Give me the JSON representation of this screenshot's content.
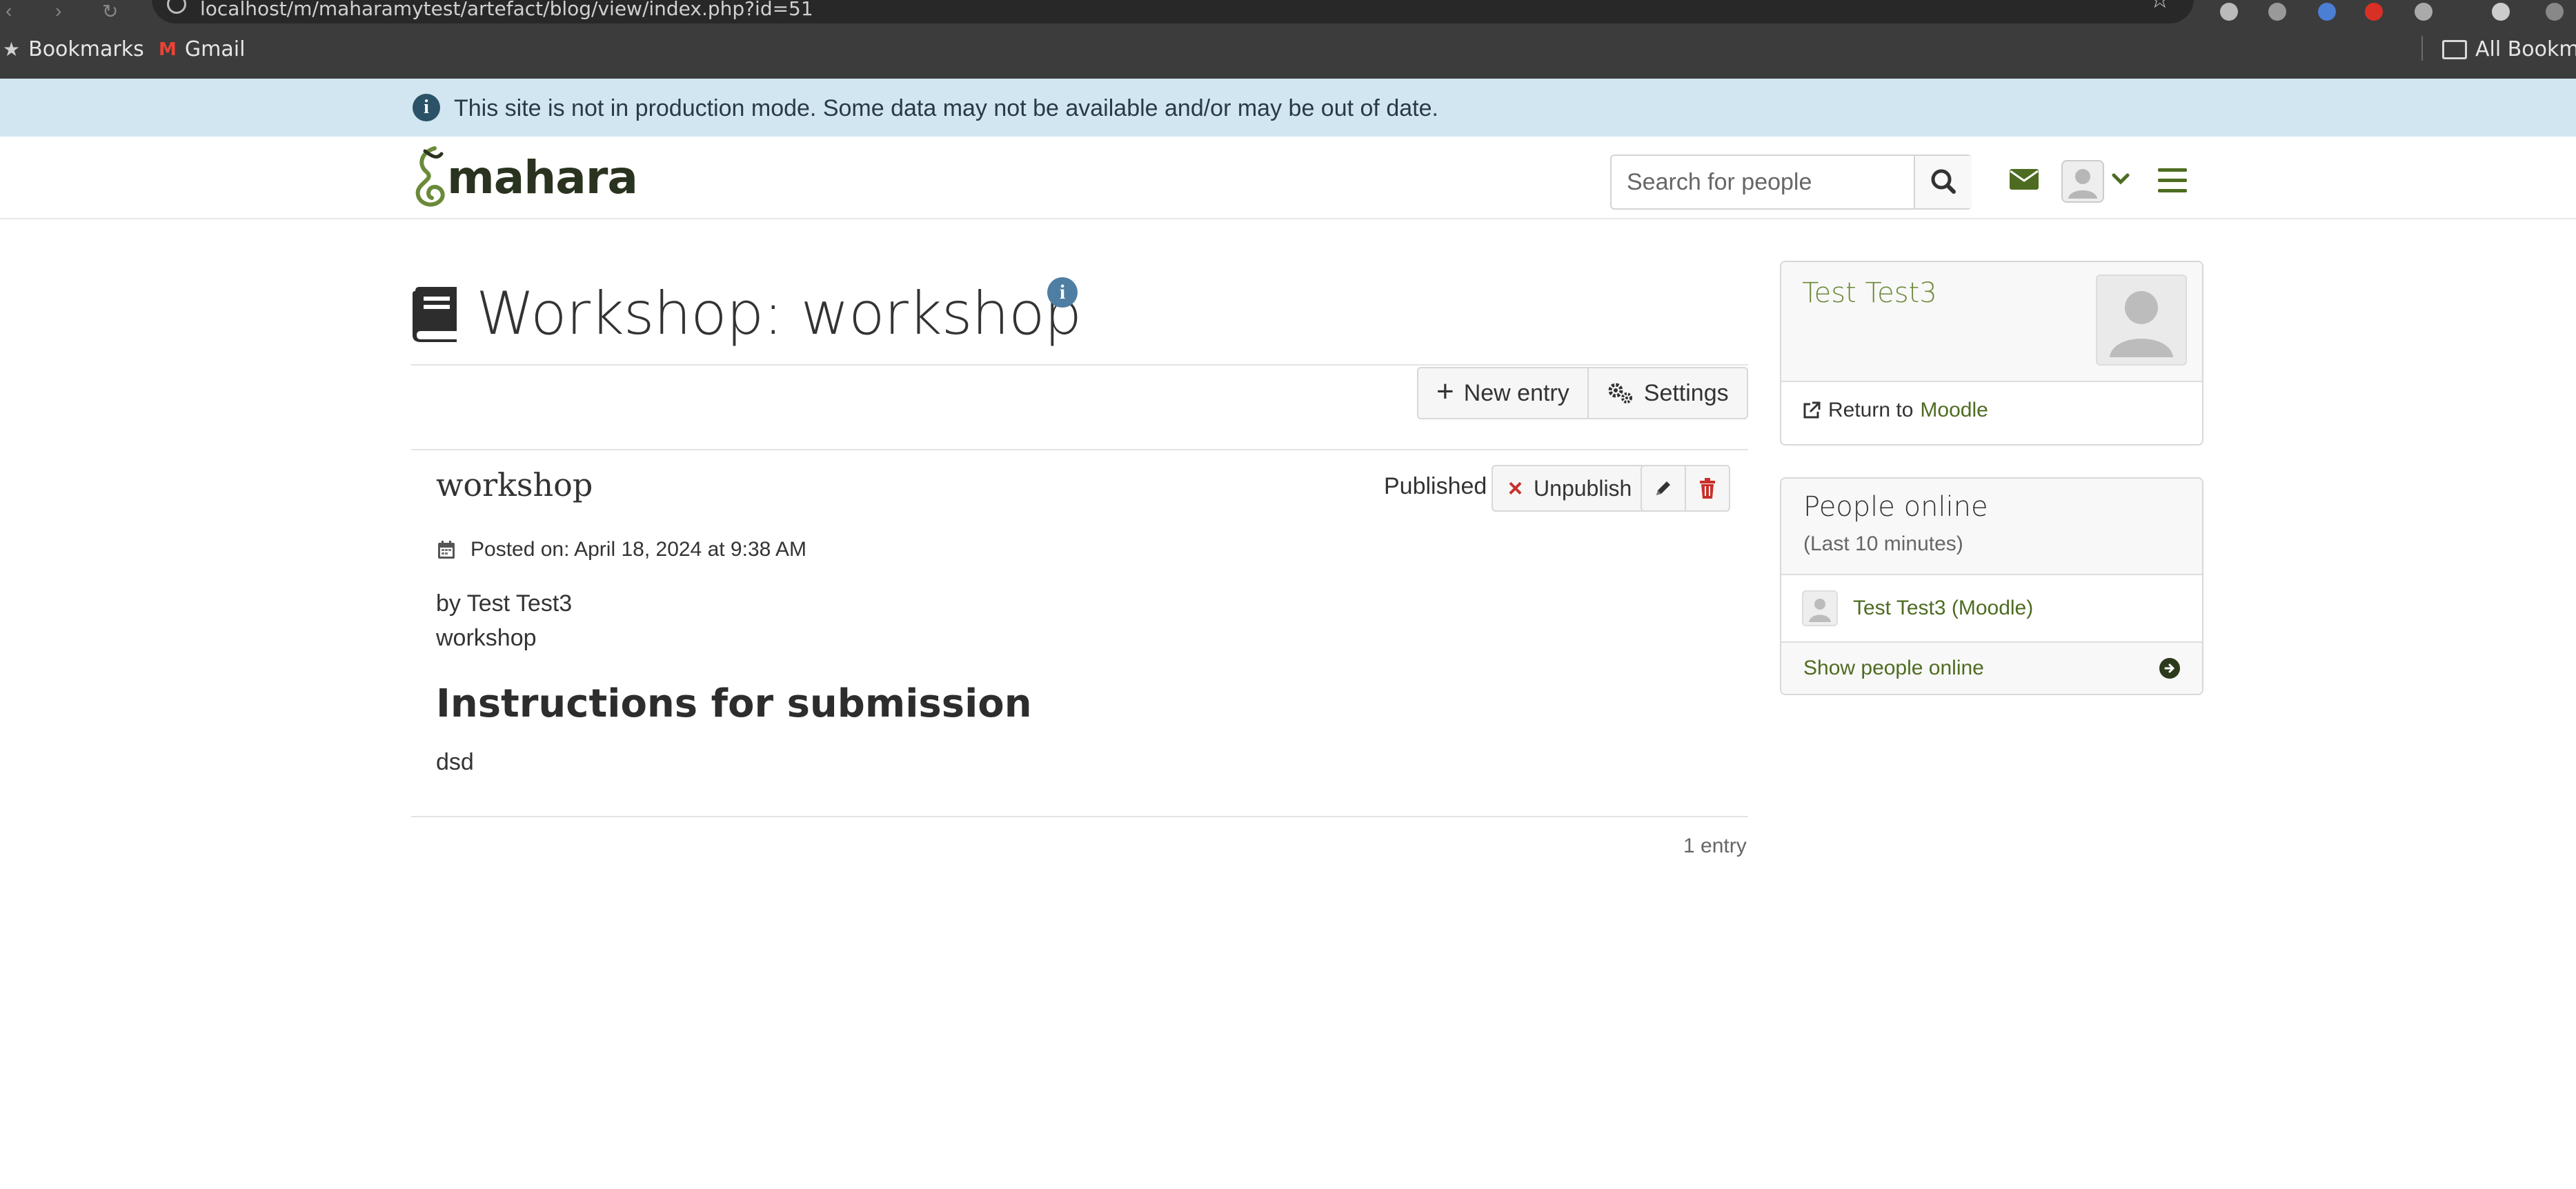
{
  "browser": {
    "url": "localhost/m/maharamytest/artefact/blog/view/index.php?id=51",
    "bookmarks": [
      {
        "label": "Bookmarks",
        "icon": "star-icon"
      },
      {
        "label": "Gmail",
        "icon": "gmail-icon"
      }
    ],
    "all_bookmarks": "All Bookmarks"
  },
  "notice": {
    "text": "This site is not in production mode. Some data may not be available and/or may be out of date."
  },
  "header": {
    "logo_text": "mahara",
    "search_placeholder": "Search for people"
  },
  "page": {
    "title": "Workshop: workshop",
    "actions": {
      "new_entry": "New entry",
      "settings": "Settings"
    }
  },
  "post": {
    "title": "workshop",
    "status": "Published",
    "unpublish": "Unpublish",
    "posted_on": "Posted on: April 18, 2024 at 9:38 AM",
    "byline": "by Test Test3",
    "body": "workshop",
    "heading": "Instructions for submission",
    "heading_body": "dsd"
  },
  "footer": {
    "entry_count": "1 entry"
  },
  "sidebar": {
    "profile": {
      "name": "Test Test3",
      "return_prefix": "Return to",
      "return_link": "Moodle"
    },
    "people_online": {
      "title": "People online",
      "subtitle": "(Last 10 minutes)",
      "people": [
        "Test Test3 (Moodle)"
      ],
      "show_link": "Show people online"
    }
  },
  "colors": {
    "brand_green": "#4e6c21",
    "notice_bg": "#d1e6f1",
    "danger": "#c9302c"
  }
}
